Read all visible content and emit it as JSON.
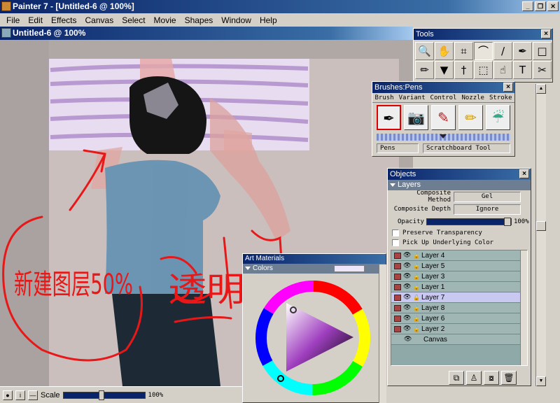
{
  "app": {
    "title": "Painter 7 - [Untitled-6 @ 100%]",
    "window_buttons": [
      "_",
      "❐",
      "✕"
    ]
  },
  "menu": [
    "File",
    "Edit",
    "Effects",
    "Canvas",
    "Select",
    "Movie",
    "Shapes",
    "Window",
    "Help"
  ],
  "document": {
    "title": "Untitled-6 @ 100%",
    "annotation_text_1": "新建图层50%",
    "annotation_text_2": "透明"
  },
  "bottombar": {
    "scale_label": "Scale",
    "scale_value": "100%"
  },
  "tools": {
    "title": "Tools",
    "icons": [
      "magnifier-icon",
      "grabber-icon",
      "crop-icon",
      "lasso-icon",
      "brush-icon",
      "pen-icon",
      "rectangle-icon",
      "pencil-icon",
      "paint-bucket-icon",
      "dropper-icon",
      "rect-select-icon",
      "layer-adjuster-icon",
      "text-icon",
      "scissors-icon"
    ],
    "glyphs": [
      "🔍",
      "✋",
      "⌗",
      "⌒",
      "∕",
      "✒",
      "□",
      "✏",
      "▼",
      "†",
      "⬚",
      "☝",
      "T",
      "✂"
    ]
  },
  "brushes": {
    "title": "Brushes:Pens",
    "tabs": [
      "Brush",
      "Variant",
      "Control",
      "Nozzle",
      "Stroke"
    ],
    "icons": [
      "pen-brush-icon",
      "camera-brush-icon",
      "felt-pen-icon",
      "pencil-brush-icon",
      "water-jar-icon"
    ],
    "glyphs": [
      "✒",
      "📷",
      "✎",
      "✏",
      "☔"
    ],
    "current_brush": "Pens",
    "current_variant": "Scratchboard Tool"
  },
  "objects": {
    "title": "Objects",
    "section": "Layers",
    "composite_method_label": "Composite Method",
    "composite_method_value": "Gel",
    "composite_depth_label": "Composite Depth",
    "composite_depth_value": "Ignore",
    "opacity_label": "Opacity",
    "opacity_value": "100%",
    "preserve_transparency": "Preserve Transparency",
    "pick_up_underlying": "Pick Up Underlying Color",
    "layers": [
      "Layer 4",
      "Layer 5",
      "Layer 3",
      "Layer 1",
      "Layer 7",
      "Layer 8",
      "Layer 6",
      "Layer 2"
    ],
    "selected_layer": "Layer 7",
    "canvas_label": "Canvas"
  },
  "art_materials": {
    "title": "Art Materials",
    "section": "Colors"
  }
}
